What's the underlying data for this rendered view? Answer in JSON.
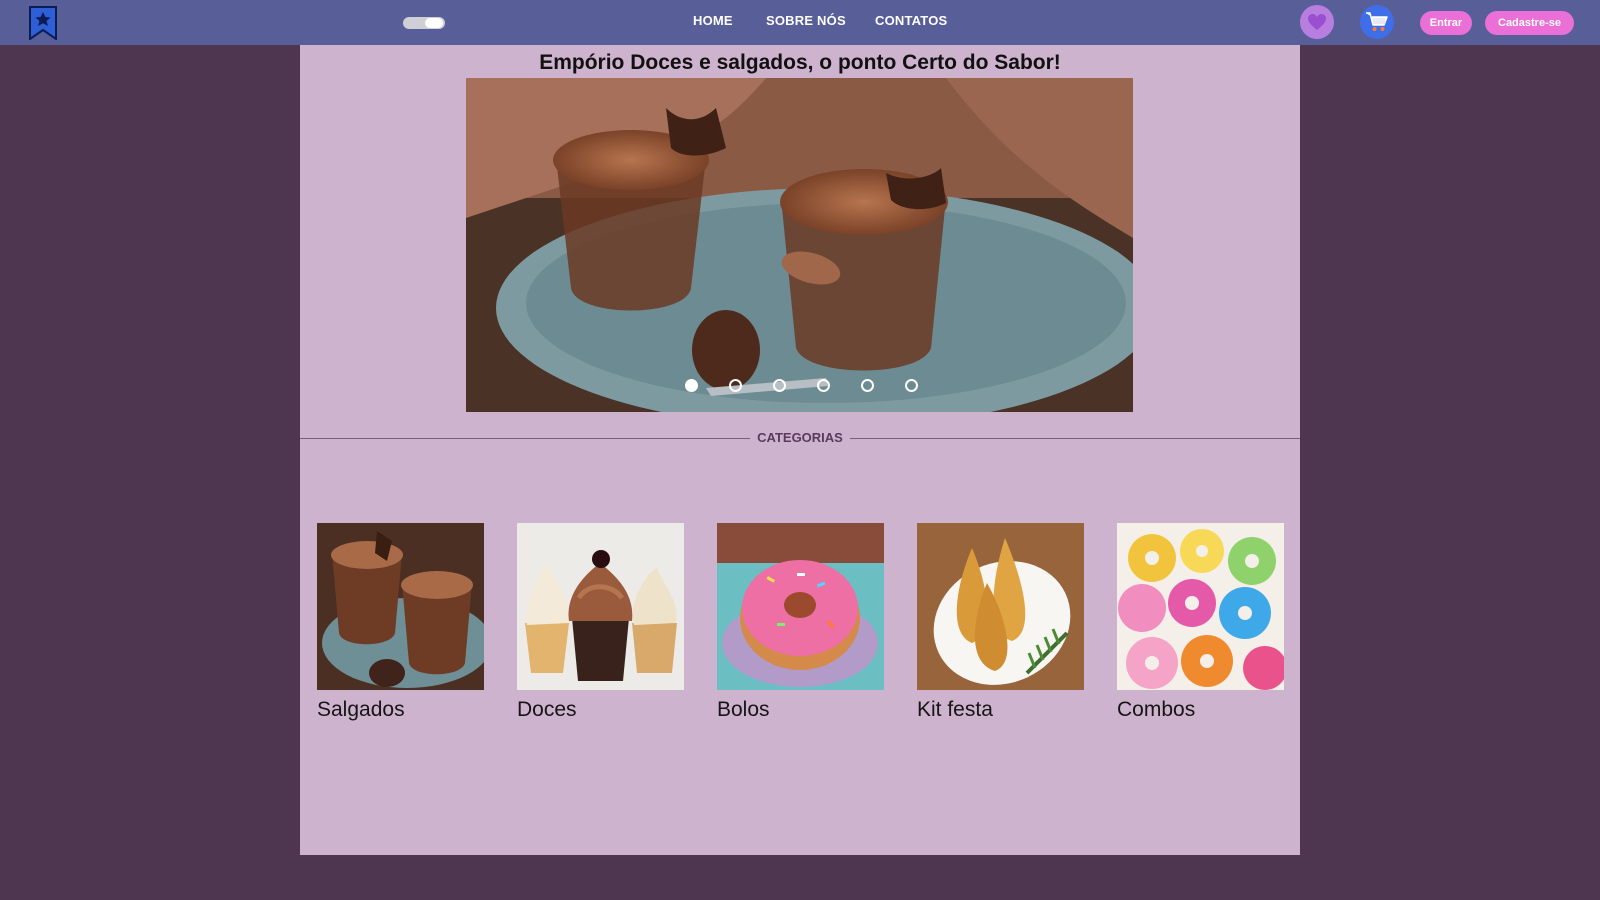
{
  "nav": {
    "links": [
      "HOME",
      "SOBRE NÓS",
      "CONTATOS"
    ],
    "login_label": "Entrar",
    "signup_label": "Cadastre-se",
    "icons": [
      "bookmark-star-icon",
      "theme-toggle",
      "heart-icon",
      "cart-icon"
    ]
  },
  "hero": {
    "title": "Empório Doces e salgados, o ponto Certo do Sabor!",
    "slide_count": 6,
    "active_slide": 1
  },
  "section": {
    "title": "CATEGORIAS"
  },
  "categories": [
    {
      "label": "Salgados"
    },
    {
      "label": "Doces"
    },
    {
      "label": "Bolos"
    },
    {
      "label": "Kit festa"
    },
    {
      "label": "Combos"
    }
  ],
  "colors": {
    "page_background": "#4e3650",
    "topbar": "#575e98",
    "panel": "#ceb3ce",
    "button": "#ea70d8",
    "favorite": "#b77ee0",
    "cart": "#3f6ee8"
  }
}
